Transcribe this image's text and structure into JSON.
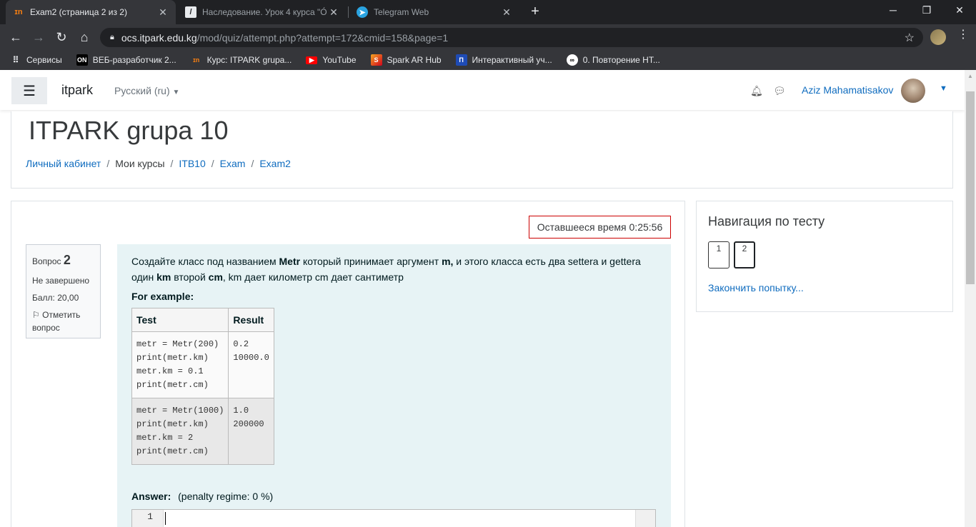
{
  "browser": {
    "tabs": [
      {
        "title": "Exam2 (страница 2 из 2)",
        "active": true
      },
      {
        "title": "Наследование. Урок 4 курса \"О́",
        "active": false
      },
      {
        "title": "Telegram Web",
        "active": false
      }
    ],
    "url_host": "ocs.itpark.edu.kg",
    "url_path": "/mod/quiz/attempt.php?attempt=172&cmid=158&page=1",
    "bookmarks": [
      {
        "label": "Сервисы"
      },
      {
        "label": "ВЕБ-разработчик 2..."
      },
      {
        "label": "Курс: ITPARK grupa..."
      },
      {
        "label": "YouTube"
      },
      {
        "label": "Spark AR Hub"
      },
      {
        "label": "Интерактивный уч..."
      },
      {
        "label": "0. Повторение HT..."
      }
    ]
  },
  "nav": {
    "brand": "itpark",
    "language": "Русский (ru)",
    "user_name": "Aziz Mahamatisakov"
  },
  "header": {
    "course_title": "ITPARK grupa 10",
    "breadcrumb": [
      "Личный кабинет",
      "Мои курсы",
      "ITB10",
      "Exam",
      "Exam2"
    ]
  },
  "quiz": {
    "timer": "Оставшееся время 0:25:56",
    "question_label": "Вопрос",
    "question_number": "2",
    "status": "Не завершено",
    "score": "Балл: 20,00",
    "flag_label": "Отметить вопрос",
    "text_part1": "Создайте класс под названием ",
    "text_bold1": "Metr",
    "text_part2": " который принимает аргумент ",
    "text_bold2": "m,",
    "text_part3": "   и этого класса есть два settera и gettera один ",
    "text_bold3": "km",
    "text_part4": " второй ",
    "text_bold4": "cm",
    "text_part5": ", km дает километр cm дает сантиметр",
    "for_example": "For example:",
    "table_headers": [
      "Test",
      "Result"
    ],
    "rows": [
      {
        "test": "metr = Metr(200)\nprint(metr.km)\nmetr.km = 0.1\nprint(metr.cm)",
        "result": "0.2\n10000.0"
      },
      {
        "test": "metr = Metr(1000)\nprint(metr.km)\nmetr.km = 2\nprint(metr.cm)",
        "result": "1.0\n200000"
      }
    ],
    "answer_label": "Answer:",
    "penalty": "(penalty regime: 0 %)",
    "editor_line": "1"
  },
  "test_nav": {
    "title": "Навигация по тесту",
    "buttons": [
      "1",
      "2"
    ],
    "finish_link": "Закончить попытку..."
  },
  "colors": {
    "link": "#0f6cbf",
    "question_bg": "#e7f3f5",
    "timer_border": "#cc0000"
  }
}
